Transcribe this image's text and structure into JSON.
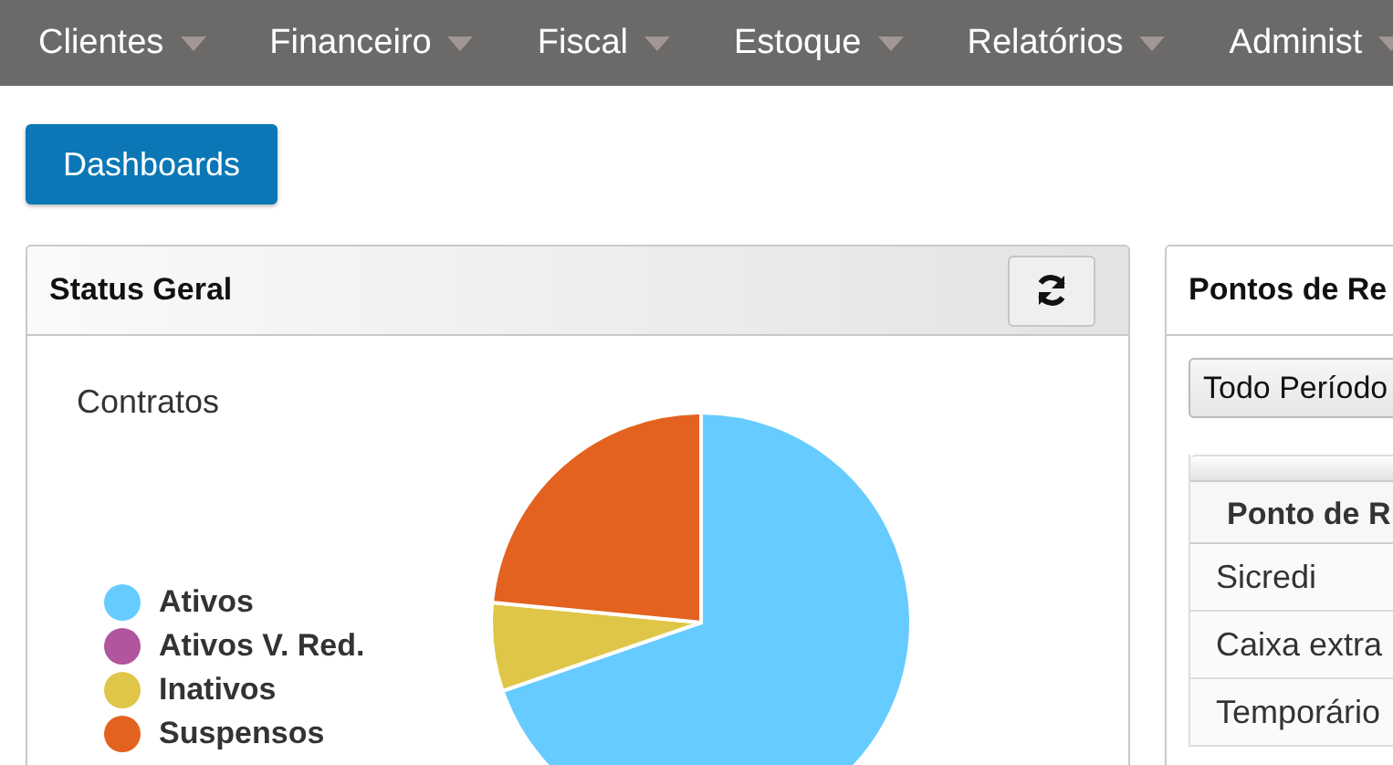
{
  "nav": {
    "items": [
      {
        "label": "Clientes"
      },
      {
        "label": "Financeiro"
      },
      {
        "label": "Fiscal"
      },
      {
        "label": "Estoque"
      },
      {
        "label": "Relatórios"
      },
      {
        "label": "Administ"
      }
    ]
  },
  "dashboards_button": "Dashboards",
  "status_panel": {
    "title": "Status Geral",
    "chart_title": "Contratos",
    "legend": [
      {
        "label": "Ativos",
        "color": "#66ccff"
      },
      {
        "label": "Ativos V. Red.",
        "color": "#b1559f"
      },
      {
        "label": "Inativos",
        "color": "#dfc648"
      },
      {
        "label": "Suspensos",
        "color": "#e46220"
      }
    ]
  },
  "points_panel": {
    "title": "Pontos de Re",
    "period_select": "Todo Período",
    "table": {
      "columns": [
        "Ponto de R"
      ],
      "rows": [
        [
          "Sicredi"
        ],
        [
          "Caixa extra"
        ],
        [
          "Temporário"
        ]
      ]
    }
  }
}
